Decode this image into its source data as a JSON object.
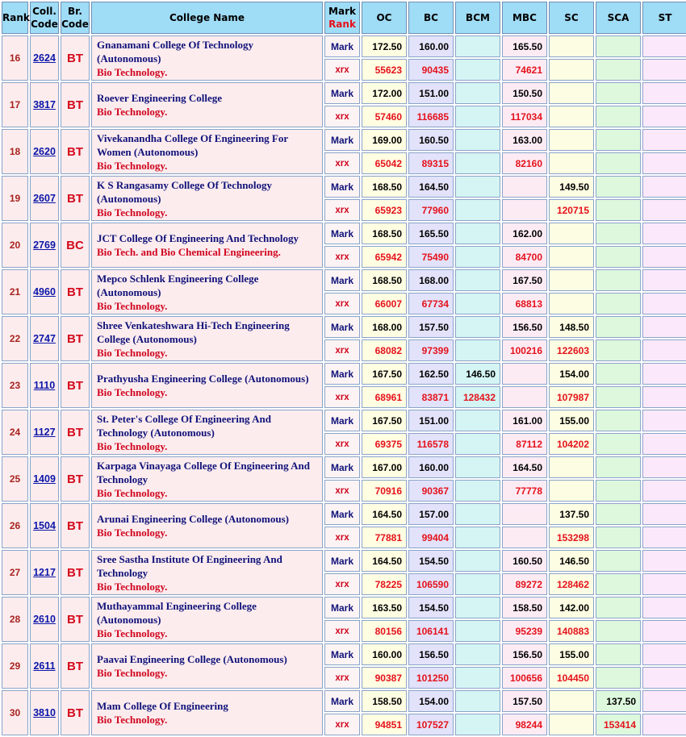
{
  "headers": {
    "rank": "Rank",
    "coll_code": "Coll. Code",
    "br_code": "Br. Code",
    "college_name": "College Name",
    "mark_rank": "Mark",
    "mark_rank_sub": "Rank",
    "categories": [
      "OC",
      "BC",
      "BCM",
      "MBC",
      "SC",
      "SCA",
      "ST"
    ]
  },
  "row_labels": {
    "mark": "Mark",
    "rank": "xrx"
  },
  "rows": [
    {
      "rank": "16",
      "code": "2624",
      "branch": "BT",
      "name": "Gnanamani College Of Technology (Autonomous)",
      "course": "Bio Technology.",
      "mark": [
        "172.50",
        "160.00",
        "",
        "165.50",
        "",
        "",
        ""
      ],
      "rnk": [
        "55623",
        "90435",
        "",
        "74621",
        "",
        "",
        ""
      ]
    },
    {
      "rank": "17",
      "code": "3817",
      "branch": "BT",
      "name": "Roever Engineering College",
      "course": "Bio Technology.",
      "mark": [
        "172.00",
        "151.00",
        "",
        "150.50",
        "",
        "",
        ""
      ],
      "rnk": [
        "57460",
        "116685",
        "",
        "117034",
        "",
        "",
        ""
      ]
    },
    {
      "rank": "18",
      "code": "2620",
      "branch": "BT",
      "name": "Vivekanandha College Of Engineering For Women (Autonomous)",
      "course": "Bio Technology.",
      "mark": [
        "169.00",
        "160.50",
        "",
        "163.00",
        "",
        "",
        ""
      ],
      "rnk": [
        "65042",
        "89315",
        "",
        "82160",
        "",
        "",
        ""
      ]
    },
    {
      "rank": "19",
      "code": "2607",
      "branch": "BT",
      "name": "K S Rangasamy College Of Technology (Autonomous)",
      "course": "Bio Technology.",
      "mark": [
        "168.50",
        "164.50",
        "",
        "",
        "149.50",
        "",
        ""
      ],
      "rnk": [
        "65923",
        "77960",
        "",
        "",
        "120715",
        "",
        ""
      ]
    },
    {
      "rank": "20",
      "code": "2769",
      "branch": "BC",
      "name": "JCT College Of Engineering And Technology",
      "course": "Bio Tech. and Bio Chemical Engineering.",
      "mark": [
        "168.50",
        "165.50",
        "",
        "162.00",
        "",
        "",
        ""
      ],
      "rnk": [
        "65942",
        "75490",
        "",
        "84700",
        "",
        "",
        ""
      ]
    },
    {
      "rank": "21",
      "code": "4960",
      "branch": "BT",
      "name": "Mepco Schlenk Engineering College (Autonomous)",
      "course": "Bio Technology.",
      "mark": [
        "168.50",
        "168.00",
        "",
        "167.50",
        "",
        "",
        ""
      ],
      "rnk": [
        "66007",
        "67734",
        "",
        "68813",
        "",
        "",
        ""
      ]
    },
    {
      "rank": "22",
      "code": "2747",
      "branch": "BT",
      "name": "Shree Venkateshwara Hi-Tech Engineering College (Autonomous)",
      "course": "Bio Technology.",
      "mark": [
        "168.00",
        "157.50",
        "",
        "156.50",
        "148.50",
        "",
        ""
      ],
      "rnk": [
        "68082",
        "97399",
        "",
        "100216",
        "122603",
        "",
        ""
      ]
    },
    {
      "rank": "23",
      "code": "1110",
      "branch": "BT",
      "name": "Prathyusha Engineering College (Autonomous)",
      "course": "Bio Technology.",
      "mark": [
        "167.50",
        "162.50",
        "146.50",
        "",
        "154.00",
        "",
        ""
      ],
      "rnk": [
        "68961",
        "83871",
        "128432",
        "",
        "107987",
        "",
        ""
      ]
    },
    {
      "rank": "24",
      "code": "1127",
      "branch": "BT",
      "name": "St. Peter's College Of Engineering And Technology (Autonomous)",
      "course": "Bio Technology.",
      "mark": [
        "167.50",
        "151.00",
        "",
        "161.00",
        "155.00",
        "",
        ""
      ],
      "rnk": [
        "69375",
        "116578",
        "",
        "87112",
        "104202",
        "",
        ""
      ]
    },
    {
      "rank": "25",
      "code": "1409",
      "branch": "BT",
      "name": "Karpaga Vinayaga College Of Engineering And Technology",
      "course": "Bio Technology.",
      "mark": [
        "167.00",
        "160.00",
        "",
        "164.50",
        "",
        "",
        ""
      ],
      "rnk": [
        "70916",
        "90367",
        "",
        "77778",
        "",
        "",
        ""
      ]
    },
    {
      "rank": "26",
      "code": "1504",
      "branch": "BT",
      "name": "Arunai Engineering College (Autonomous)",
      "course": "Bio Technology.",
      "mark": [
        "164.50",
        "157.00",
        "",
        "",
        "137.50",
        "",
        ""
      ],
      "rnk": [
        "77881",
        "99404",
        "",
        "",
        "153298",
        "",
        ""
      ]
    },
    {
      "rank": "27",
      "code": "1217",
      "branch": "BT",
      "name": "Sree Sastha Institute Of Engineering And Technology",
      "course": "Bio Technology.",
      "mark": [
        "164.50",
        "154.50",
        "",
        "160.50",
        "146.50",
        "",
        ""
      ],
      "rnk": [
        "78225",
        "106590",
        "",
        "89272",
        "128462",
        "",
        ""
      ]
    },
    {
      "rank": "28",
      "code": "2610",
      "branch": "BT",
      "name": "Muthayammal Engineering College (Autonomous)",
      "course": "Bio Technology.",
      "mark": [
        "163.50",
        "154.50",
        "",
        "158.50",
        "142.00",
        "",
        ""
      ],
      "rnk": [
        "80156",
        "106141",
        "",
        "95239",
        "140883",
        "",
        ""
      ]
    },
    {
      "rank": "29",
      "code": "2611",
      "branch": "BT",
      "name": "Paavai Engineering College (Autonomous)",
      "course": "Bio Technology.",
      "mark": [
        "160.00",
        "156.50",
        "",
        "156.50",
        "155.00",
        "",
        ""
      ],
      "rnk": [
        "90387",
        "101250",
        "",
        "100656",
        "104450",
        "",
        ""
      ]
    },
    {
      "rank": "30",
      "code": "3810",
      "branch": "BT",
      "name": "Mam College Of Engineering",
      "course": "Bio Technology.",
      "mark": [
        "158.50",
        "154.00",
        "",
        "157.50",
        "",
        "137.50",
        ""
      ],
      "rnk": [
        "94851",
        "107527",
        "",
        "98244",
        "",
        "153414",
        ""
      ]
    }
  ]
}
